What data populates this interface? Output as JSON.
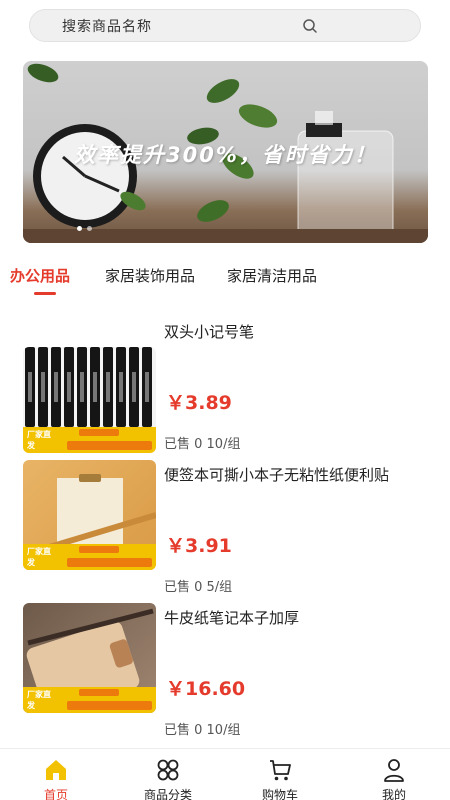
{
  "search": {
    "placeholder": "搜索商品名称"
  },
  "banner": {
    "headline": "效率提升300%，省时省力！"
  },
  "tabs": [
    {
      "label": "办公用品",
      "active": true
    },
    {
      "label": "家居装饰用品",
      "active": false
    },
    {
      "label": "家居清洁用品",
      "active": false
    }
  ],
  "products": [
    {
      "title": "双头小记号笔",
      "price": "￥3.89",
      "sales": "已售 0 10/组",
      "image_badge": "厂家直发"
    },
    {
      "title": "便签本可撕小本子无粘性纸便利贴",
      "price": "￥3.91",
      "sales": "已售 0 5/组",
      "image_badge": "厂家直发"
    },
    {
      "title": "牛皮纸笔记本子加厚",
      "price": "￥16.60",
      "sales": "已售 0 10/组",
      "image_badge": "厂家直发"
    }
  ],
  "nav": [
    {
      "label": "首页",
      "icon": "home-icon",
      "active": true
    },
    {
      "label": "商品分类",
      "icon": "category-icon",
      "active": false
    },
    {
      "label": "购物车",
      "icon": "cart-icon",
      "active": false
    },
    {
      "label": "我的",
      "icon": "user-icon",
      "active": false
    }
  ],
  "colors": {
    "accent": "#e53b2c",
    "badge": "#f2c200"
  }
}
